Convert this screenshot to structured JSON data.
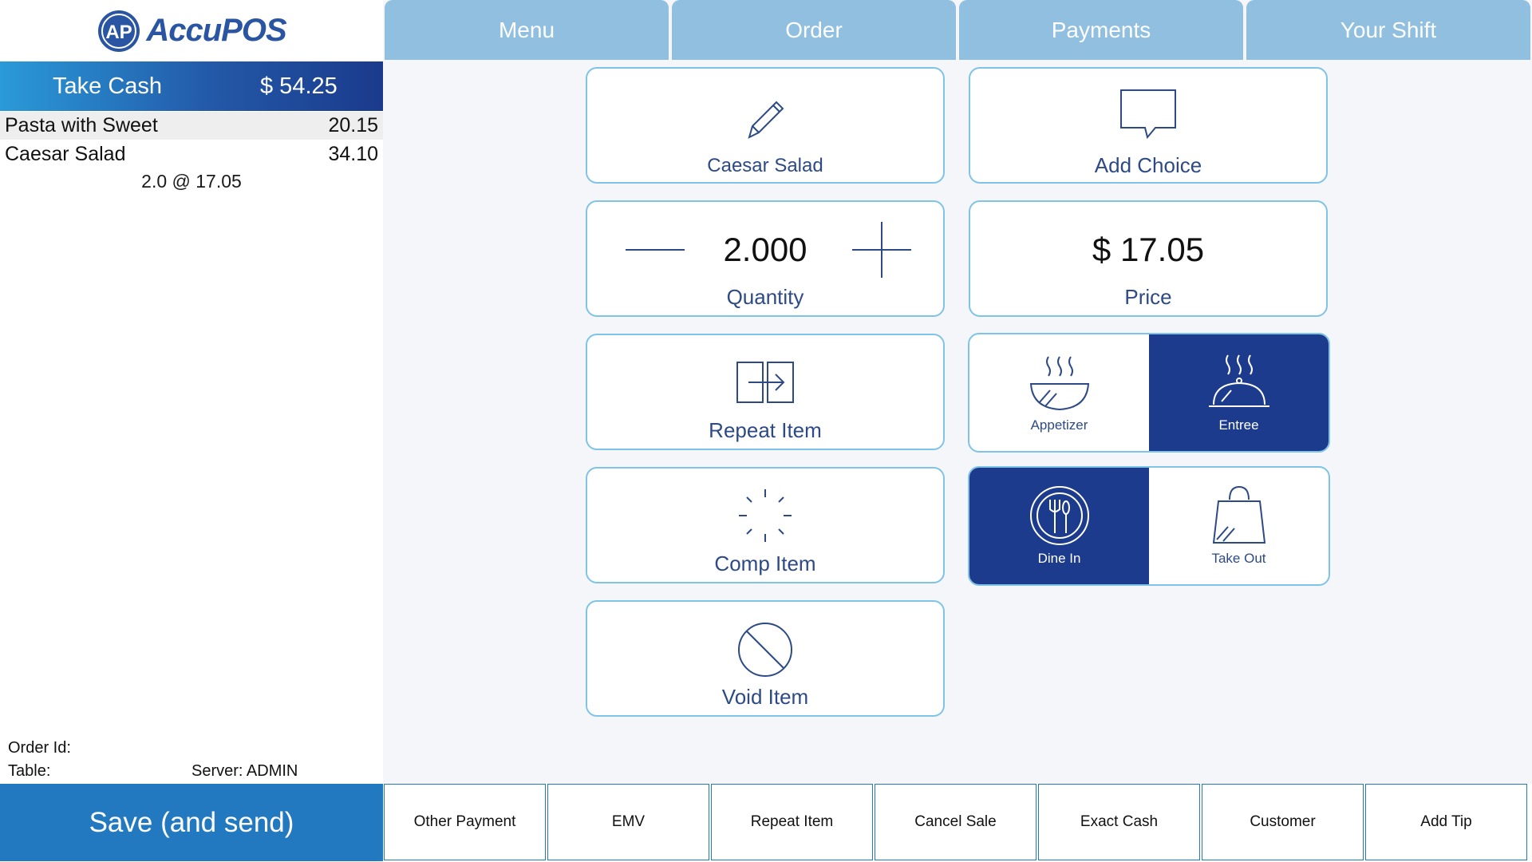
{
  "app": {
    "logo_text": "AccuPOS",
    "logo_mark": "AP"
  },
  "tabs": [
    {
      "label": "Menu"
    },
    {
      "label": "Order"
    },
    {
      "label": "Payments"
    },
    {
      "label": "Your Shift"
    }
  ],
  "ticket": {
    "take_cash_label": "Take Cash",
    "take_cash_amount": "$ 54.25",
    "lines": [
      {
        "name": "Pasta with Sweet",
        "price": "20.15"
      },
      {
        "name": "Caesar Salad",
        "price": "34.10",
        "detail": "2.0 @ 17.05"
      }
    ],
    "order_id_label": "Order Id:",
    "table_label": "Table:",
    "server_label": "Server: ADMIN"
  },
  "actions": {
    "item_name": "Caesar Salad",
    "add_choice": "Add Choice",
    "quantity_value": "2.000",
    "quantity_label": "Quantity",
    "price_value": "$ 17.05",
    "price_label": "Price",
    "repeat_item": "Repeat Item",
    "comp_item": "Comp Item",
    "void_item": "Void Item",
    "course": {
      "appetizer": "Appetizer",
      "entree": "Entree",
      "selected": "Entree"
    },
    "service": {
      "dine_in": "Dine In",
      "take_out": "Take Out",
      "selected": "Dine In"
    }
  },
  "bottom_bar": {
    "save": "Save (and send)",
    "buttons": [
      "Other Payment",
      "EMV",
      "Repeat Item",
      "Cancel Sale",
      "Exact Cash",
      "Customer",
      "Add Tip"
    ]
  },
  "colors": {
    "brand_blue": "#2a55a2",
    "tab_blue": "#90bfe0",
    "selected_navy": "#1d3b8d",
    "card_border": "#7fc3e6",
    "save_button": "#2279c0"
  }
}
